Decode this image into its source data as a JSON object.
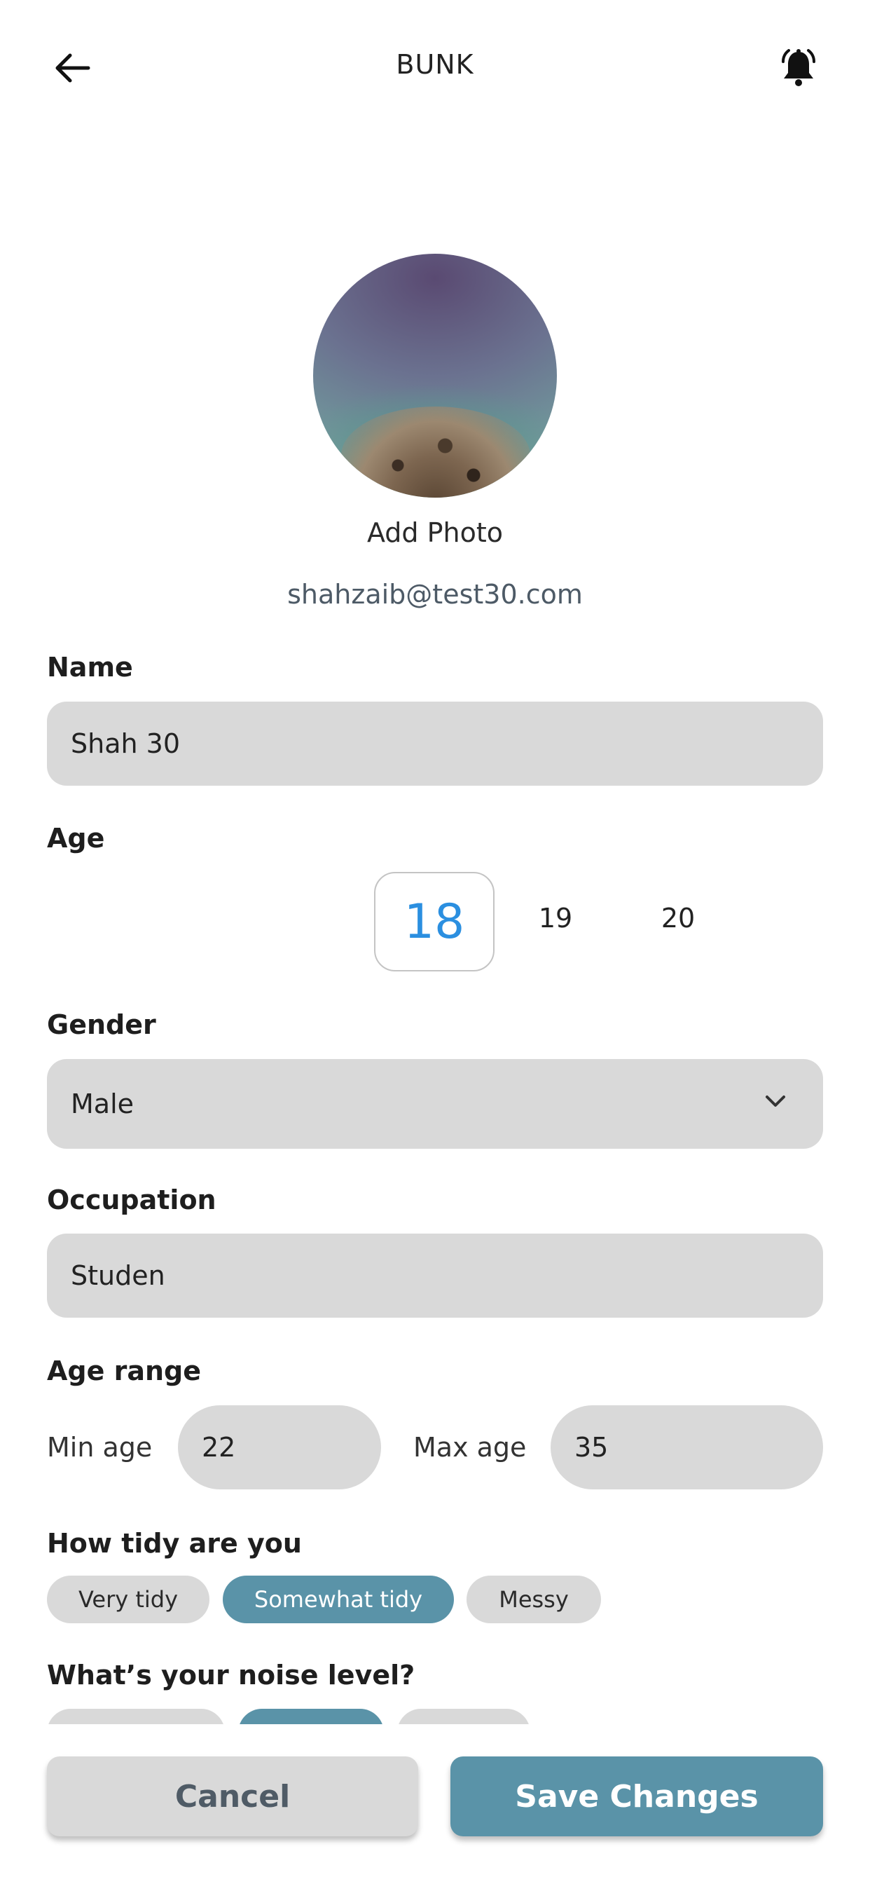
{
  "header": {
    "title": "BUNK",
    "back_icon": "arrow-left-icon",
    "bell_icon": "bell-ringing-icon"
  },
  "profile": {
    "add_photo_label": "Add Photo",
    "email": "shahzaib@test30.com"
  },
  "form": {
    "name_label": "Name",
    "name_value": "Shah 30",
    "age_label": "Age",
    "age_options": [
      "18",
      "19",
      "20"
    ],
    "age_selected": "18",
    "gender_label": "Gender",
    "gender_value": "Male",
    "occupation_label": "Occupation",
    "occupation_value": "Studen",
    "age_range_label": "Age range",
    "min_age_label": "Min age",
    "min_age_value": "22",
    "max_age_label": "Max age",
    "max_age_value": "35",
    "tidy_label": "How tidy are you",
    "tidy_options": [
      "Very tidy",
      "Somewhat tidy",
      "Messy"
    ],
    "tidy_selected": "Somewhat tidy",
    "noise_label": "What’s your noise level?"
  },
  "actions": {
    "cancel_label": "Cancel",
    "save_label": "Save Changes"
  },
  "colors": {
    "accent": "#5a93a8",
    "field_bg": "#d9d9d9",
    "age_selected": "#2b8fe0"
  }
}
